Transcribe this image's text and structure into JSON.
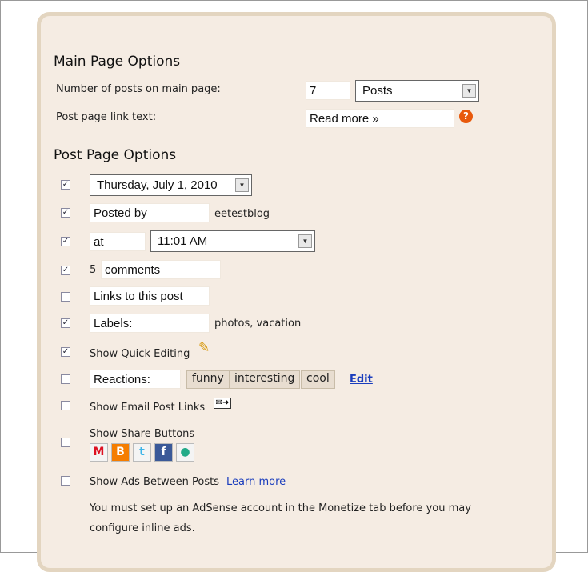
{
  "main_page": {
    "heading": "Main Page Options",
    "posts_label": "Number of posts on main page:",
    "posts_value": "7",
    "posts_unit": "Posts",
    "link_label": "Post page link text:",
    "link_value": "Read more »"
  },
  "post_page": {
    "heading": "Post Page Options",
    "date": {
      "checked": true,
      "value": "Thursday, July 1, 2010"
    },
    "posted_by": {
      "checked": true,
      "value": "Posted by",
      "author": "eetestblog"
    },
    "time": {
      "checked": true,
      "prefix": "at",
      "value": "11:01 AM"
    },
    "comments": {
      "checked": true,
      "count": "5",
      "value": "comments"
    },
    "backlinks": {
      "checked": false,
      "value": "Links to this post"
    },
    "labels": {
      "checked": true,
      "value": "Labels:",
      "list": "photos, vacation"
    },
    "quick_edit": {
      "checked": true,
      "label": "Show Quick Editing"
    },
    "reactions": {
      "checked": false,
      "value": "Reactions:",
      "options": [
        "funny",
        "interesting",
        "cool"
      ],
      "edit": "Edit"
    },
    "email": {
      "checked": false,
      "label": "Show Email Post Links"
    },
    "share": {
      "checked": false,
      "label": "Show Share Buttons",
      "buttons": [
        "gmail",
        "blogger",
        "twitter",
        "facebook",
        "buzz"
      ]
    },
    "ads": {
      "checked": false,
      "label": "Show Ads Between Posts",
      "link": "Learn more",
      "note1": "You must set up an AdSense account in the Monetize tab before you may",
      "note2": "configure inline ads."
    }
  }
}
